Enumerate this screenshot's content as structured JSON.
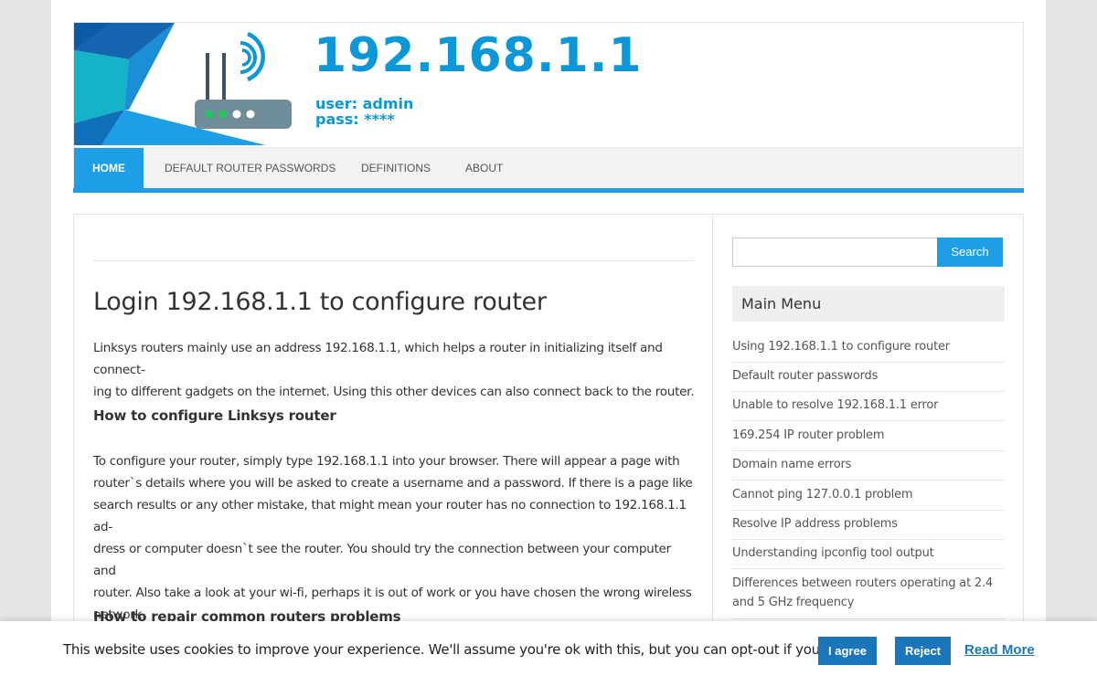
{
  "site": {
    "title": "192.168.1.1",
    "user_line": "user: admin",
    "pass_line": "pass: ****",
    "accent_color": "#1e9ee6",
    "logo_icon": "router-icon"
  },
  "nav": {
    "items": [
      {
        "label": "HOME",
        "active": true
      },
      {
        "label": "DEFAULT ROUTER PASSWORDS",
        "active": false
      },
      {
        "label": "DEFINITIONS",
        "active": false
      },
      {
        "label": "ABOUT",
        "active": false
      }
    ]
  },
  "article": {
    "title": "Login 192.168.1.1 to configure router",
    "intro_1": "Linksys routers mainly use an address 192.168.1.1, which helps a router in initializing itself and connect-",
    "intro_2": "ing to different gadgets on the internet. Using this other devices can also connect back to the router.",
    "h_configure": "How to configure Linksys router",
    "body_lines": [
      "To configure your router, simply type 192.168.1.1 into your browser. There will appear a page with",
      "router`s details where you will be asked to create a username and a password. If there is a page like",
      "search results or any other mistake, that might mean your router has no connection to 192.168.1.1 ad-",
      "dress or computer doesn`t see the router. You should try the connection between your computer and",
      "router. Also take a look at your wi-fi, perhaps it is out of work or you have chosen the wrong wireless",
      "network."
    ],
    "h_repair": "How to repair common routers problems"
  },
  "sidebar": {
    "search_value": "",
    "search_button": "Search",
    "menu_title": "Main Menu",
    "menu_items": [
      "Using 192.168.1.1 to configure router",
      "Default router passwords",
      "Unable to resolve 192.168.1.1 error",
      "169.254 IP router problem",
      "Domain name errors",
      "Cannot ping 127.0.0.1 problem",
      "Resolve IP address problems",
      "Understanding ipconfig tool output",
      "Differences between routers operating at 2.4 and 5 GHz frequency"
    ]
  },
  "cookie": {
    "text": "This website uses cookies to improve your experience. We'll assume you're ok with this, but you can opt-out if you wish.",
    "agree": "I agree",
    "reject": "Reject",
    "read_more": "Read More"
  }
}
